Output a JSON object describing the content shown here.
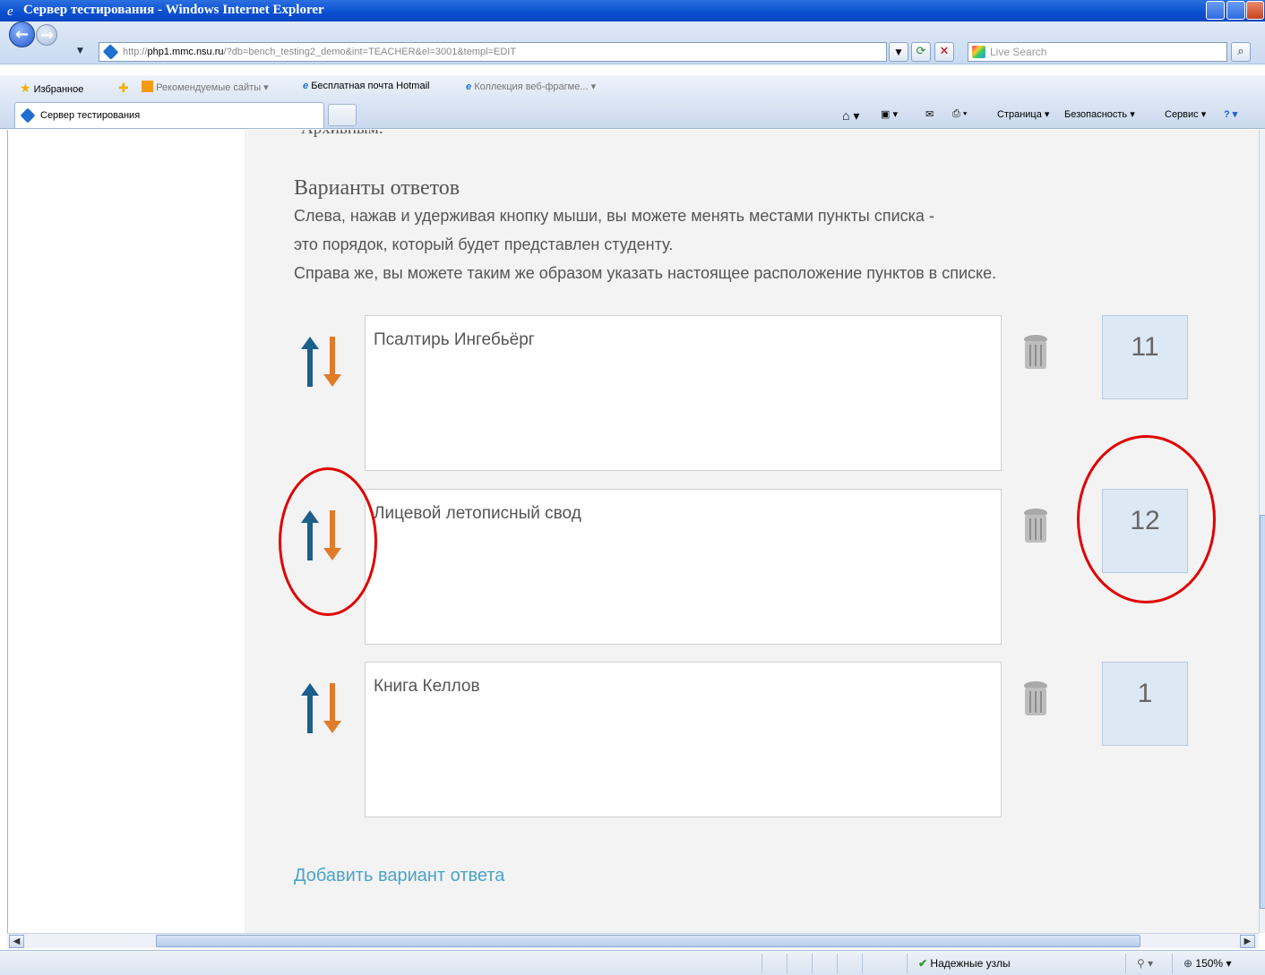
{
  "window": {
    "title": "Сервер тестирования - Windows Internet Explorer"
  },
  "address": {
    "url_prefix": "http://",
    "url_host": "php1.mmc.nsu.ru",
    "url_rest": "/?db=bench_testing2_demo&int=TEACHER&el=3001&templ=EDIT",
    "search_placeholder": "Live Search"
  },
  "favorites": {
    "label": "Избранное",
    "items": [
      "Рекомендуемые сайты ▾",
      "Бесплатная почта Hotmail",
      "Коллекция веб-фрагме... ▾"
    ]
  },
  "tab": {
    "title": "Сервер тестирования"
  },
  "commandbar": {
    "page": "Страница ▾",
    "safety": "Безопасность ▾",
    "tools": "Сервис ▾"
  },
  "content": {
    "cutoff_text": "Архивным.",
    "heading": "Варианты ответов",
    "instructions": [
      "Слева, нажав и удерживая кнопку мыши, вы можете менять местами пункты списка -",
      "это порядок, который будет представлен студенту.",
      "Справа же, вы можете таким же образом указать настоящее расположение пунктов в списке."
    ],
    "answers": [
      {
        "text": "Псалтирь Ингебьёрг",
        "position": "11"
      },
      {
        "text": "Лицевой летописный свод",
        "position": "12"
      },
      {
        "text": "Книга Келлов",
        "position": "1"
      }
    ],
    "add_link": "Добавить вариант ответа"
  },
  "statusbar": {
    "zone": "Надежные узлы",
    "zoom": "150%"
  },
  "colors": {
    "annotation_circle": "#e00000",
    "link": "#4aa3c9",
    "arrow_up": "#1c5f8a",
    "arrow_down": "#e07b2a"
  }
}
